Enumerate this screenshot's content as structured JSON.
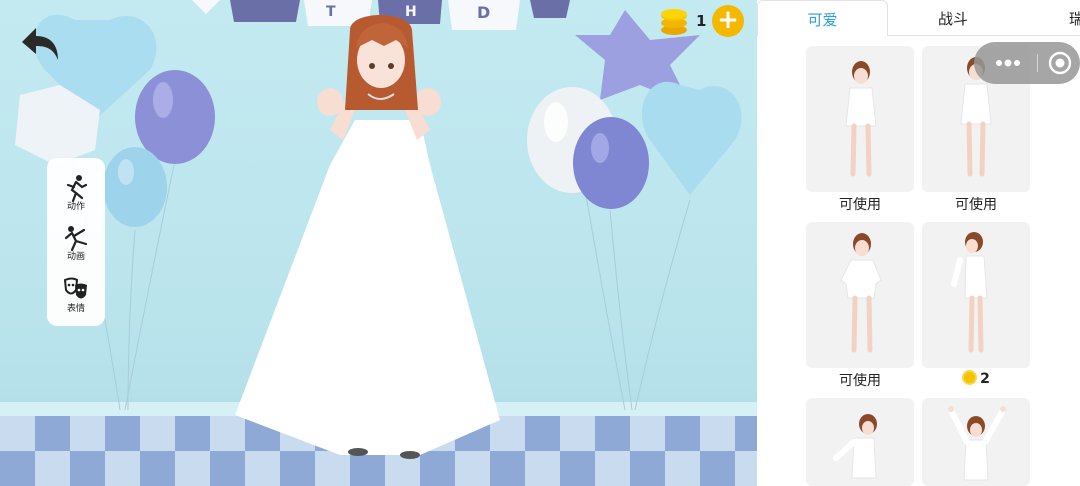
{
  "scene": {
    "banner": {
      "letters": [
        "T",
        "H",
        "D"
      ]
    },
    "side_menu": [
      {
        "id": "action",
        "label": "动作",
        "icon": "running-figure-icon"
      },
      {
        "id": "animation",
        "label": "动画",
        "icon": "dancing-figure-icon"
      },
      {
        "id": "expression",
        "label": "表情",
        "icon": "theater-masks-icon"
      }
    ],
    "back_icon": "back-arrow-icon",
    "coins": {
      "count": "1",
      "add_label": "+"
    }
  },
  "panel": {
    "tabs": [
      {
        "label": "可爱",
        "active": true
      },
      {
        "label": "战斗",
        "active": false
      },
      {
        "label": "瑞",
        "active": false
      }
    ],
    "capsule": {
      "menu_label": "•••",
      "close_icon": "target-circle-icon"
    },
    "cards": [
      {
        "pose": "standing-arms-down",
        "status": "可使用"
      },
      {
        "pose": "standing-arms-down",
        "status": "可使用"
      },
      {
        "pose": "standing-arms-out",
        "status": "可使用"
      },
      {
        "pose": "standing-side-view",
        "price": "2",
        "status": ""
      },
      {
        "pose": "leaning-arm-out",
        "status": ""
      },
      {
        "pose": "arms-raised",
        "status": ""
      }
    ]
  },
  "colors": {
    "accent": "#2ba0d6",
    "coin": "#f5b800",
    "scene_bg": "#c4eaf1"
  }
}
